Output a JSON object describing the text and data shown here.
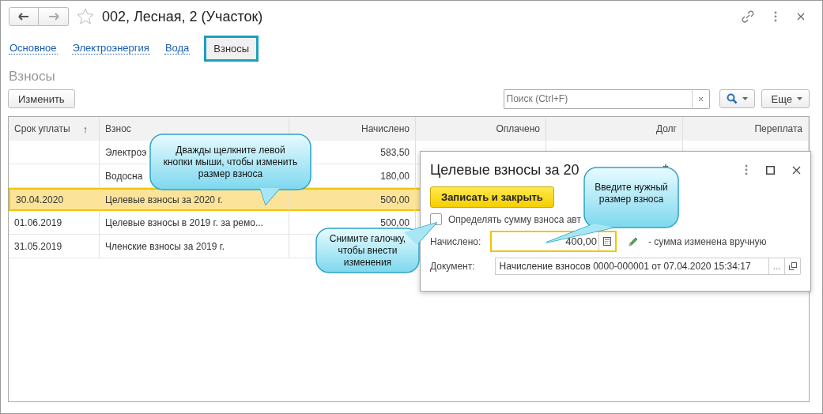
{
  "window": {
    "title": "002, Лесная, 2 (Участок)"
  },
  "tabs": [
    {
      "label": "Основное",
      "selected": false
    },
    {
      "label": "Электроэнергия",
      "selected": false
    },
    {
      "label": "Вода",
      "selected": false
    },
    {
      "label": "Взносы",
      "selected": true
    }
  ],
  "section_title": "Взносы",
  "toolbar": {
    "edit_button": "Изменить",
    "search": {
      "placeholder": "Поиск (Ctrl+F)"
    },
    "more_button": "Еще"
  },
  "table": {
    "columns": [
      {
        "label": "Срок уплаты",
        "sort": "↑"
      },
      {
        "label": "Взнос"
      },
      {
        "label": "Начислено"
      },
      {
        "label": "Оплачено"
      },
      {
        "label": "Долг"
      },
      {
        "label": "Переплата"
      }
    ],
    "rows": [
      {
        "cells": [
          "",
          "Электроэ",
          "583,50"
        ],
        "selected": false
      },
      {
        "cells": [
          "",
          "Водосна",
          "180,00"
        ],
        "selected": false
      },
      {
        "cells": [
          "30.04.2020",
          "Целевые взносы за 2020 г.",
          "500,00"
        ],
        "selected": true
      },
      {
        "cells": [
          "01.06.2019",
          "Целевые взносы в 2019 г. за ремо...",
          "500,00"
        ],
        "selected": false
      },
      {
        "cells": [
          "31.05.2019",
          "Членские взносы за 2019 г."
        ],
        "selected": false
      }
    ]
  },
  "dialog": {
    "title": "Целевые взносы за 20",
    "modified_mark": "*",
    "save_button": "Записать и закрыть",
    "auto_checkbox": {
      "label": "Определять сумму взноса авт",
      "checked": false
    },
    "charged": {
      "label": "Начислено:",
      "value": "400,00",
      "note": "- сумма изменена вручную"
    },
    "document": {
      "label": "Документ:",
      "value": "Начисление взносов 0000-000001 от 07.04.2020 15:34:17",
      "select_button": "..."
    }
  },
  "callouts": [
    {
      "text": "Дважды щелкните левой кнопки мыши, чтобы изменить размер взноса"
    },
    {
      "text": "Снимите галочку, чтобы внести изменения"
    },
    {
      "text": "Введите нужный размер взноса"
    }
  ]
}
